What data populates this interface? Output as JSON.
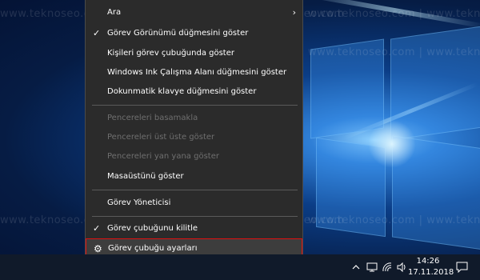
{
  "menu": {
    "items": [
      {
        "label": "Ara",
        "checked": false,
        "disabled": false,
        "submenu": true
      },
      {
        "label": "Görev Görünümü düğmesini göster",
        "checked": true,
        "disabled": false
      },
      {
        "label": "Kişileri görev çubuğunda göster",
        "checked": false,
        "disabled": false
      },
      {
        "label": "Windows Ink Çalışma Alanı düğmesini göster",
        "checked": false,
        "disabled": false
      },
      {
        "label": "Dokunmatik klavye düğmesini göster",
        "checked": false,
        "disabled": false
      },
      {
        "label": "Pencereleri basamakla",
        "checked": false,
        "disabled": true
      },
      {
        "label": "Pencereleri üst üste göster",
        "checked": false,
        "disabled": true
      },
      {
        "label": "Pencereleri yan yana göster",
        "checked": false,
        "disabled": true
      },
      {
        "label": "Masaüstünü göster",
        "checked": false,
        "disabled": false
      },
      {
        "label": "Görev Yöneticisi",
        "checked": false,
        "disabled": false
      },
      {
        "label": "Görev çubuğunu kilitle",
        "checked": true,
        "disabled": false
      },
      {
        "label": "Görev çubuğu ayarları",
        "checked": false,
        "disabled": false,
        "icon": "gear-icon",
        "highlighted": true
      }
    ]
  },
  "watermark": "www.teknoseo.com | www.teknoseo.com | www.teknoseo.com",
  "taskbar": {
    "time": "14:26",
    "date": "17.11.2018",
    "tray_icons": [
      "chevron-up-icon",
      "network-icon",
      "wifi-icon",
      "volume-icon",
      "notification-icon"
    ]
  },
  "colors": {
    "highlight_border": "#e01010",
    "menu_bg": "#2b2b2b"
  }
}
